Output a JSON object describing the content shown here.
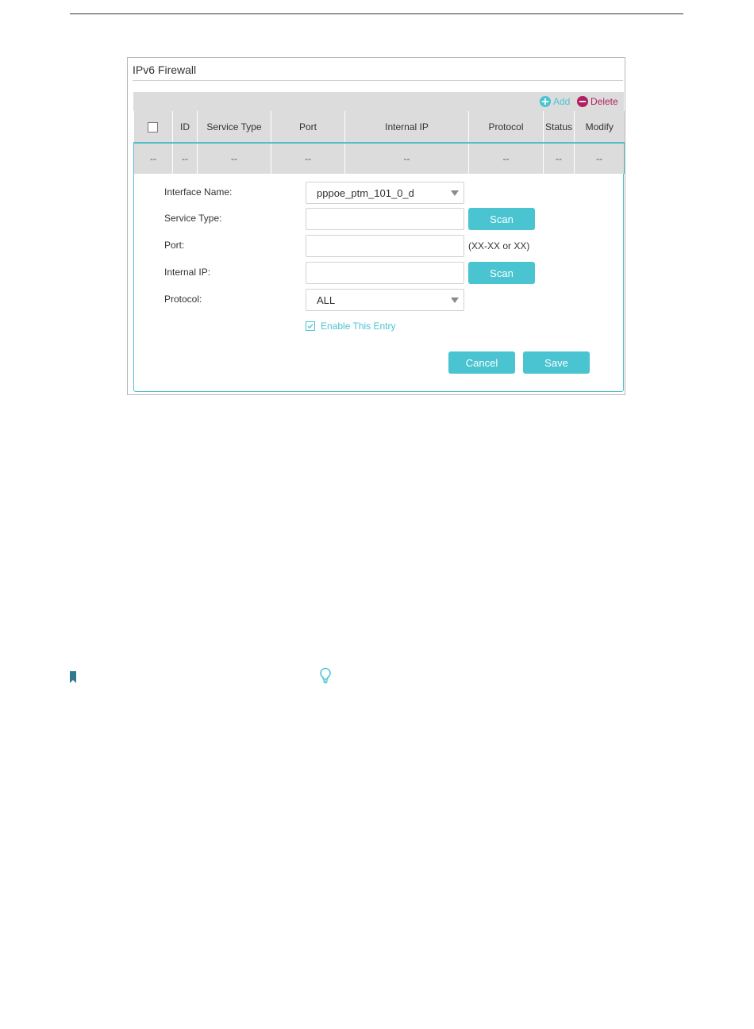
{
  "panel": {
    "title": "IPv6 Firewall"
  },
  "toolbar": {
    "add_label": "Add",
    "delete_label": "Delete",
    "add_icon": "plus-circle-icon",
    "delete_icon": "minus-circle-icon"
  },
  "table": {
    "columns": [
      "ID",
      "Service Type",
      "Port",
      "Internal IP",
      "Protocol",
      "Status",
      "Modify"
    ],
    "row": [
      "--",
      "--",
      "--",
      "--",
      "--",
      "--",
      "--",
      "--"
    ]
  },
  "form": {
    "interface_name_label": "Interface Name:",
    "interface_name_value": "pppoe_ptm_101_0_d",
    "service_type_label": "Service Type:",
    "service_type_value": "",
    "port_label": "Port:",
    "port_value": "",
    "port_hint": "(XX-XX or XX)",
    "internal_ip_label": "Internal IP:",
    "internal_ip_value": "",
    "protocol_label": "Protocol:",
    "protocol_value": "ALL",
    "scan_label": "Scan",
    "enable_label": "Enable This Entry",
    "enable_checked": true,
    "cancel_label": "Cancel",
    "save_label": "Save"
  },
  "colors": {
    "accent": "#4ac4d1",
    "delete": "#b01f5f",
    "header_bg": "#dcdcdc",
    "row_border": "#52bfc9"
  },
  "page_icons": {
    "note_icon": "bookmark-icon",
    "tip_icon": "lightbulb-icon"
  }
}
